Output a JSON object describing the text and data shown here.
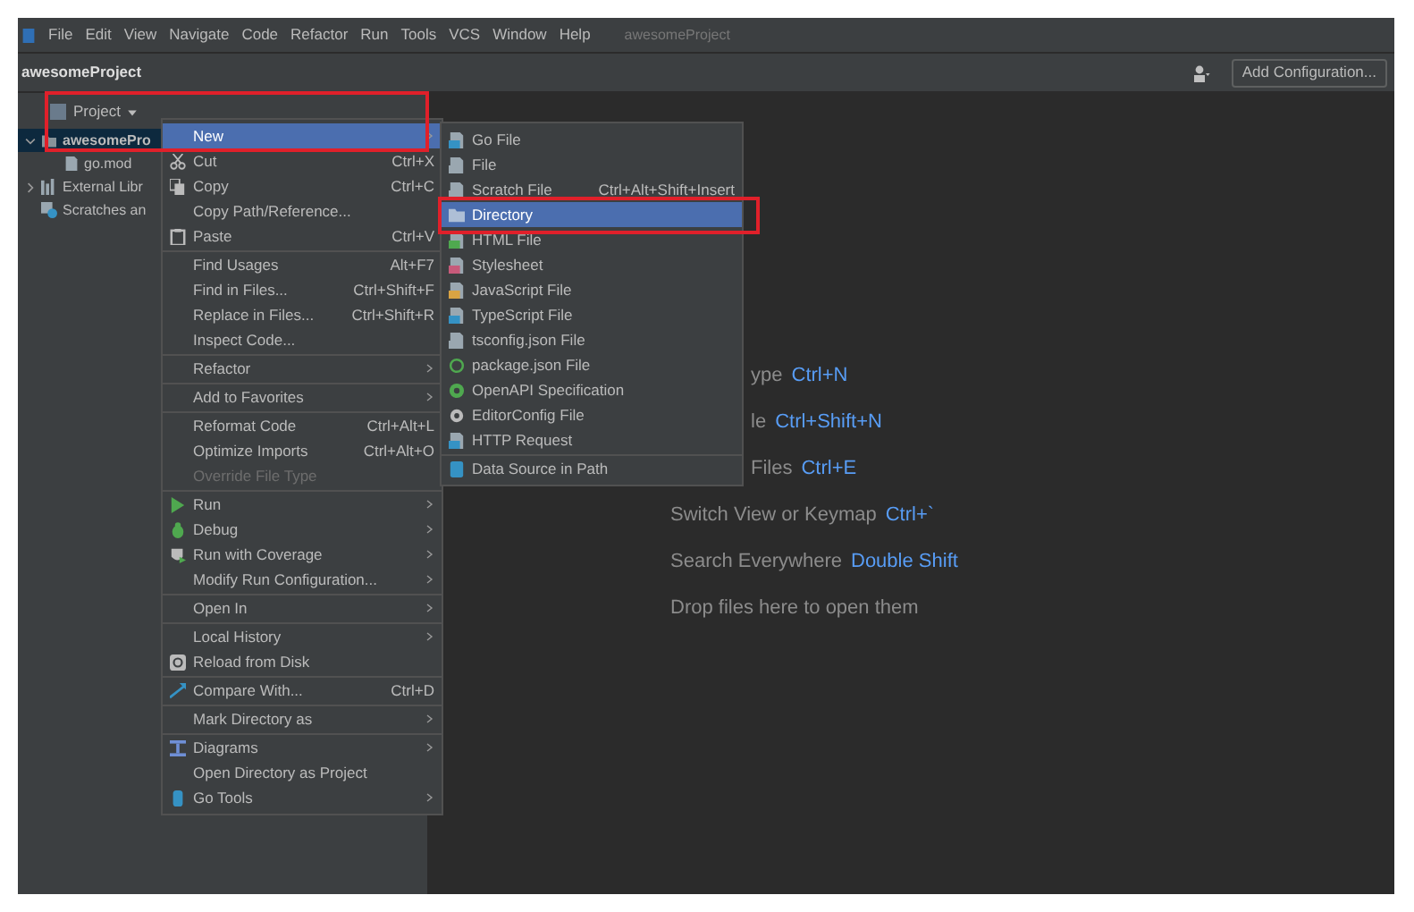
{
  "menu_bar": {
    "items": [
      "File",
      "Edit",
      "View",
      "Navigate",
      "Code",
      "Refactor",
      "Run",
      "Tools",
      "VCS",
      "Window",
      "Help"
    ],
    "title": "awesomeProject"
  },
  "navigation_bar": {
    "project": "awesomeProject",
    "config_button": "Add Configuration..."
  },
  "project_panel": {
    "title": "Project",
    "tree": [
      {
        "label": "awesomePro",
        "selected": true,
        "expanded": true,
        "children": [
          {
            "label": "go.mod",
            "selected": false
          }
        ]
      },
      {
        "label": "External Libr",
        "selected": false,
        "expanded": false
      },
      {
        "label": "Scratches an",
        "selected": false
      }
    ]
  },
  "context_menu": {
    "items": [
      {
        "kind": "item",
        "label": "New",
        "selected": true,
        "submenu": true
      },
      {
        "kind": "item",
        "label": "Cut",
        "shortcut": "Ctrl+X"
      },
      {
        "kind": "item",
        "label": "Copy",
        "shortcut": "Ctrl+C"
      },
      {
        "kind": "item",
        "label": "Copy Path/Reference..."
      },
      {
        "kind": "item",
        "label": "Paste",
        "shortcut": "Ctrl+V"
      },
      {
        "kind": "separator"
      },
      {
        "kind": "item",
        "label": "Find Usages",
        "shortcut": "Alt+F7"
      },
      {
        "kind": "item",
        "label": "Find in Files...",
        "shortcut": "Ctrl+Shift+F"
      },
      {
        "kind": "item",
        "label": "Replace in Files...",
        "shortcut": "Ctrl+Shift+R"
      },
      {
        "kind": "item",
        "label": "Inspect Code..."
      },
      {
        "kind": "separator"
      },
      {
        "kind": "item",
        "label": "Refactor",
        "submenu": true
      },
      {
        "kind": "separator"
      },
      {
        "kind": "item",
        "label": "Add to Favorites",
        "submenu": true
      },
      {
        "kind": "separator"
      },
      {
        "kind": "item",
        "label": "Reformat Code",
        "shortcut": "Ctrl+Alt+L"
      },
      {
        "kind": "item",
        "label": "Optimize Imports",
        "shortcut": "Ctrl+Alt+O"
      },
      {
        "kind": "item",
        "label": "Override File Type",
        "disabled": true
      },
      {
        "kind": "separator"
      },
      {
        "kind": "item",
        "label": "Run",
        "submenu": true
      },
      {
        "kind": "item",
        "label": "Debug",
        "submenu": true
      },
      {
        "kind": "item",
        "label": "Run with Coverage",
        "submenu": true
      },
      {
        "kind": "item",
        "label": "Modify Run Configuration...",
        "submenu": true
      },
      {
        "kind": "separator"
      },
      {
        "kind": "item",
        "label": "Open In",
        "submenu": true
      },
      {
        "kind": "separator"
      },
      {
        "kind": "item",
        "label": "Local History",
        "submenu": true
      },
      {
        "kind": "item",
        "label": "Reload from Disk"
      },
      {
        "kind": "separator"
      },
      {
        "kind": "item",
        "label": "Compare With...",
        "shortcut": "Ctrl+D"
      },
      {
        "kind": "separator"
      },
      {
        "kind": "item",
        "label": "Mark Directory as",
        "submenu": true
      },
      {
        "kind": "separator"
      },
      {
        "kind": "item",
        "label": "Diagrams",
        "submenu": true
      },
      {
        "kind": "item",
        "label": "Open Directory as Project"
      },
      {
        "kind": "item",
        "label": "Go Tools",
        "submenu": true
      }
    ]
  },
  "new_submenu": {
    "items": [
      {
        "kind": "item",
        "label": "Go File",
        "selected": false
      },
      {
        "kind": "item",
        "label": "File",
        "selected": false
      },
      {
        "kind": "item",
        "label": "Scratch File",
        "shortcut": "Ctrl+Alt+Shift+Insert",
        "selected": false
      },
      {
        "kind": "item",
        "label": "Directory",
        "selected": true
      },
      {
        "kind": "item",
        "label": "HTML File",
        "selected": false
      },
      {
        "kind": "item",
        "label": "Stylesheet",
        "selected": false
      },
      {
        "kind": "item",
        "label": "JavaScript File",
        "selected": false
      },
      {
        "kind": "item",
        "label": "TypeScript File",
        "selected": false
      },
      {
        "kind": "item",
        "label": "tsconfig.json File",
        "selected": false
      },
      {
        "kind": "item",
        "label": "package.json File",
        "selected": false
      },
      {
        "kind": "item",
        "label": "OpenAPI Specification",
        "selected": false
      },
      {
        "kind": "item",
        "label": "EditorConfig File",
        "selected": false
      },
      {
        "kind": "item",
        "label": "HTTP Request",
        "selected": false
      },
      {
        "kind": "separator"
      },
      {
        "kind": "item",
        "label": "Data Source in Path",
        "selected": false
      }
    ]
  },
  "editor_hints": [
    {
      "kind": "partial",
      "label": "ype",
      "shortcut": "Ctrl+N"
    },
    {
      "kind": "partial",
      "label": "le",
      "shortcut": "Ctrl+Shift+N"
    },
    {
      "kind": "partial",
      "label": "Files",
      "shortcut": "Ctrl+E"
    },
    {
      "kind": "full",
      "label": "Switch View or Keymap",
      "shortcut": "Ctrl+`"
    },
    {
      "kind": "full",
      "label": "Search Everywhere",
      "shortcut": "Double Shift"
    },
    {
      "kind": "full",
      "label": "Drop files here to open them"
    }
  ]
}
